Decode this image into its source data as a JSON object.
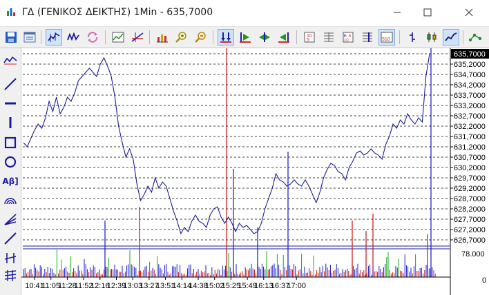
{
  "window": {
    "title": "ΓΔ (ΓΕΝΙΚΟΣ ΔΕΙΚΤΗΣ) 1Min - 635,7000",
    "icon": "chart-app-icon"
  },
  "toolbar": {
    "icons": [
      "save-icon",
      "properties-icon",
      "chart-style-icon",
      "indicators-icon",
      "refresh-icon",
      "template-icon",
      "studies-icon",
      "volume-icon",
      "zoom-in-icon",
      "zoom-out-icon",
      "autoscroll-icon",
      "scroll-start-icon",
      "scroll-both-icon",
      "scroll-end-icon",
      "price-table-icon",
      "grid-icon",
      "bid-ask-icon",
      "time-sales-icon",
      "bar-chart-icon",
      "candlestick-icon",
      "line-chart-icon",
      "connect-icon"
    ]
  },
  "left_toolbar": {
    "icons": [
      "indicator-line-icon",
      "trend-line-icon",
      "horizontal-line-icon",
      "vertical-line-icon",
      "rectangle-icon",
      "ellipse-icon",
      "text-tool-icon",
      "fibonacci-arc-icon",
      "fan-icon",
      "channel-icon",
      "cross-icon",
      "fibonacci-icon"
    ],
    "text_tool_label": "Aβ]"
  },
  "colors": {
    "price_line": "#1a1aa0",
    "volume_up": "#cc1111",
    "volume_down": "#1a1ad0",
    "volume_neutral": "#11aa11",
    "marker_red": "#cc1111",
    "marker_blue": "#1111cc",
    "current_price_bg": "#000000",
    "grid": "#000000"
  },
  "chart_data": {
    "type": "line",
    "current_price_label": "635,7000",
    "ylim": [
      626.5,
      635.7
    ],
    "y_ticks": [
      "635,7000",
      "635,2000",
      "634,7000",
      "634,2000",
      "633,7000",
      "633,2000",
      "632,7000",
      "632,2000",
      "631,7000",
      "631,2000",
      "630,7000",
      "630,2000",
      "629,7000",
      "629,2000",
      "628,7000",
      "628,2000",
      "627,7000",
      "627,2000",
      "626,7000"
    ],
    "x_ticks": [
      "10:41",
      "11:05",
      "11:28",
      "11:52",
      "12:16",
      "12:39",
      "13:03",
      "13:27",
      "13:51",
      "14:14",
      "14:38",
      "15:02",
      "15:25",
      "15:49",
      "16:13",
      "16:37",
      "17:00"
    ],
    "series": [
      {
        "values": [
          631.4,
          631.2,
          631.6,
          632.0,
          632.3,
          632.1,
          632.6,
          633.4,
          632.9,
          633.6,
          632.8,
          633.1,
          633.6,
          633.4,
          633.8,
          634.4,
          634.6,
          634.8,
          635.0,
          634.8,
          634.6,
          635.2,
          635.5,
          635.1,
          634.6,
          633.6,
          632.2,
          631.4,
          630.7,
          631.1,
          630.6,
          629.4,
          628.6,
          628.9,
          629.3,
          629.0,
          629.7,
          629.2,
          629.5,
          629.3,
          628.7,
          628.1,
          627.6,
          627.0,
          627.3,
          627.1,
          627.6,
          627.9,
          627.6,
          627.5,
          627.3,
          627.9,
          628.2,
          628.3,
          627.8,
          627.5,
          627.8,
          627.5,
          627.1,
          627.5,
          627.3,
          627.4,
          627.2,
          627.0,
          627.1,
          627.5,
          628.2,
          628.7,
          629.2,
          629.9,
          629.6,
          629.5,
          629.3,
          629.4,
          629.6,
          629.4,
          629.3,
          629.6,
          629.3,
          628.9,
          628.5,
          629.0,
          629.7,
          630.1,
          630.4,
          630.3,
          630.0,
          629.9,
          629.6,
          630.2,
          630.5,
          630.9,
          631.0,
          630.8,
          630.9,
          631.1,
          630.9,
          630.8,
          630.6,
          631.3,
          631.7,
          632.3,
          632.1,
          632.5,
          632.3,
          632.8,
          632.5,
          632.3,
          632.6,
          632.4,
          634.6,
          635.7
        ],
        "color": "#1a1aa0"
      }
    ],
    "volume": {
      "max_label": "78.000",
      "min_label": "0",
      "max": 78000
    }
  }
}
